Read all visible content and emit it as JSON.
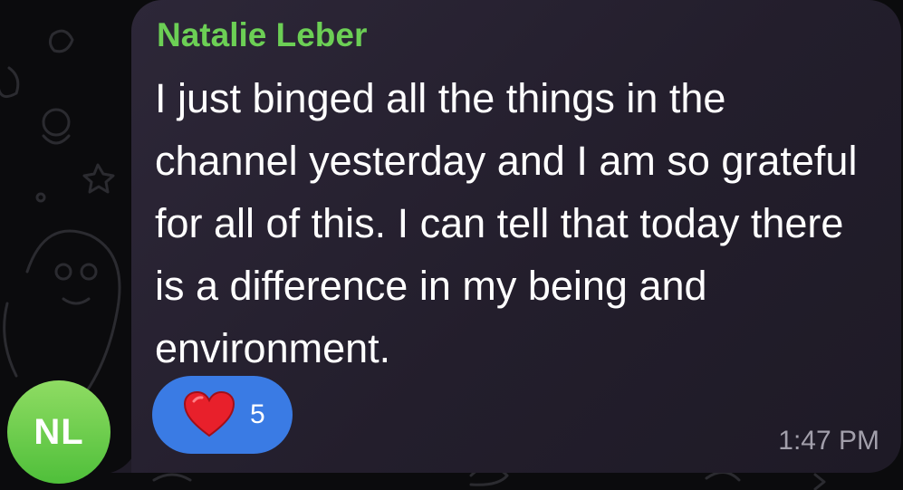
{
  "message": {
    "sender_name": "Natalie Leber",
    "text": "I just binged all the things in the channel yesterday and I am so grateful for all of this. I can tell that today there is a difference in my being and environment.",
    "time": "1:47 PM",
    "avatar_initials": "NL",
    "reaction": {
      "emoji": "heart-icon",
      "count": "5"
    }
  },
  "colors": {
    "sender": "#6ccf55",
    "avatar": "#5ccb47",
    "reaction_pill": "#3a7be4",
    "bubble": "#27212f"
  }
}
